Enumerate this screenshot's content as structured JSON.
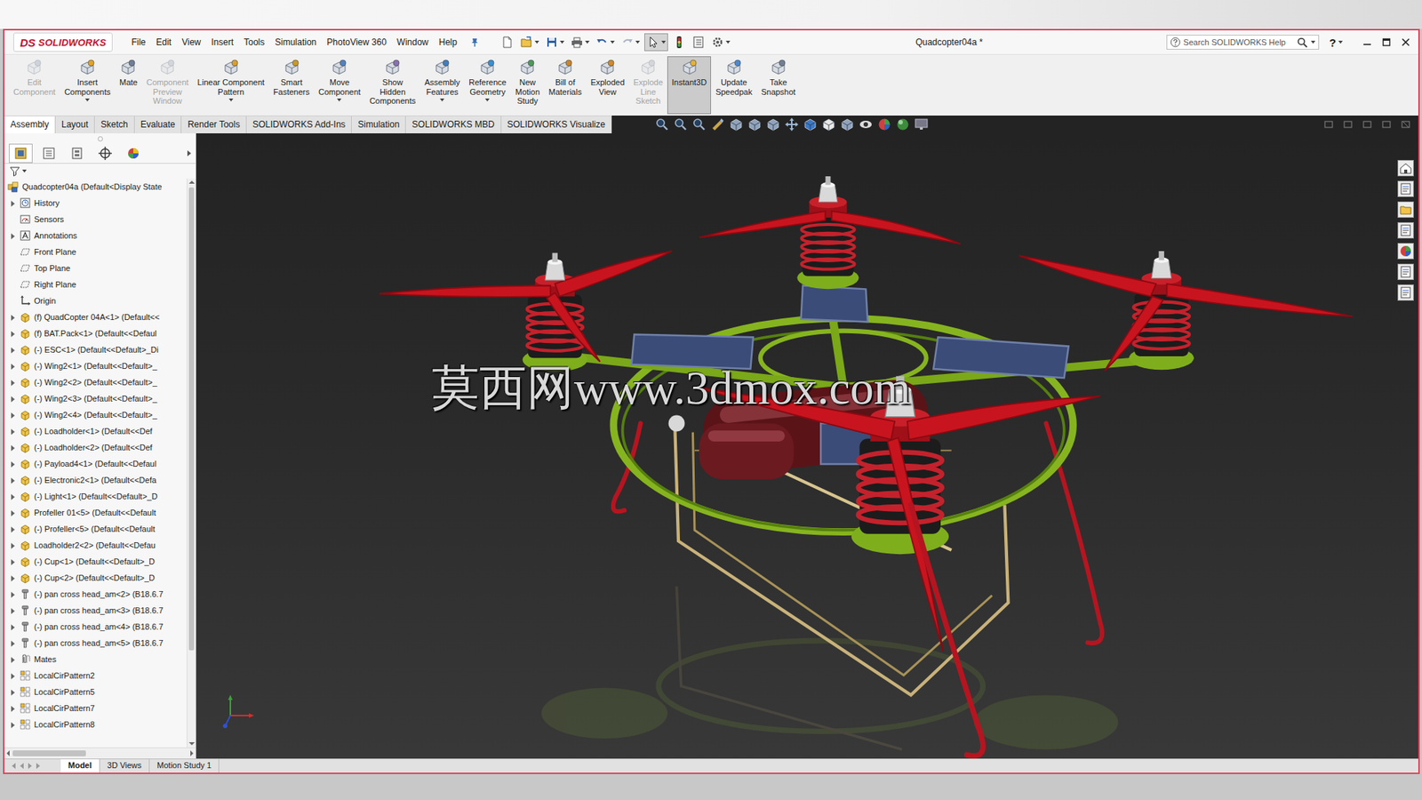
{
  "window": {
    "title": "Quadcopter04a *"
  },
  "logo": {
    "mark": "DS",
    "name": "SOLIDWORKS"
  },
  "menu": [
    "File",
    "Edit",
    "View",
    "Insert",
    "Tools",
    "Simulation",
    "PhotoView 360",
    "Window",
    "Help"
  ],
  "search": {
    "placeholder": "Search SOLIDWORKS Help"
  },
  "help_button": "?",
  "command_buttons": [
    {
      "lines": [
        "Edit",
        "Component"
      ],
      "disabled": true,
      "selected": false,
      "dropdown": false
    },
    {
      "lines": [
        "Insert",
        "Components"
      ],
      "disabled": false,
      "selected": false,
      "dropdown": true
    },
    {
      "lines": [
        "Mate"
      ],
      "disabled": false,
      "selected": false,
      "dropdown": false
    },
    {
      "lines": [
        "Component",
        "Preview",
        "Window"
      ],
      "disabled": true,
      "selected": false,
      "dropdown": false
    },
    {
      "lines": [
        "Linear Component",
        "Pattern"
      ],
      "disabled": false,
      "selected": false,
      "dropdown": true
    },
    {
      "lines": [
        "Smart",
        "Fasteners"
      ],
      "disabled": false,
      "selected": false,
      "dropdown": false
    },
    {
      "lines": [
        "Move",
        "Component"
      ],
      "disabled": false,
      "selected": false,
      "dropdown": true
    },
    {
      "lines": [
        "Show",
        "Hidden",
        "Components"
      ],
      "disabled": false,
      "selected": false,
      "dropdown": false
    },
    {
      "lines": [
        "Assembly",
        "Features"
      ],
      "disabled": false,
      "selected": false,
      "dropdown": true
    },
    {
      "lines": [
        "Reference",
        "Geometry"
      ],
      "disabled": false,
      "selected": false,
      "dropdown": true
    },
    {
      "lines": [
        "New",
        "Motion",
        "Study"
      ],
      "disabled": false,
      "selected": false,
      "dropdown": false
    },
    {
      "lines": [
        "Bill of",
        "Materials"
      ],
      "disabled": false,
      "selected": false,
      "dropdown": false
    },
    {
      "lines": [
        "Exploded",
        "View"
      ],
      "disabled": false,
      "selected": false,
      "dropdown": false
    },
    {
      "lines": [
        "Explode",
        "Line",
        "Sketch"
      ],
      "disabled": true,
      "selected": false,
      "dropdown": false
    },
    {
      "lines": [
        "Instant3D"
      ],
      "disabled": false,
      "selected": true,
      "dropdown": false
    },
    {
      "lines": [
        "Update",
        "Speedpak"
      ],
      "disabled": false,
      "selected": false,
      "dropdown": false
    },
    {
      "lines": [
        "Take",
        "Snapshot"
      ],
      "disabled": false,
      "selected": false,
      "dropdown": false
    }
  ],
  "tabs": [
    {
      "label": "Assembly",
      "selected": true
    },
    {
      "label": "Layout",
      "selected": false
    },
    {
      "label": "Sketch",
      "selected": false
    },
    {
      "label": "Evaluate",
      "selected": false
    },
    {
      "label": "Render Tools",
      "selected": false
    },
    {
      "label": "SOLIDWORKS Add-Ins",
      "selected": false
    },
    {
      "label": "Simulation",
      "selected": false
    },
    {
      "label": "SOLIDWORKS MBD",
      "selected": false
    },
    {
      "label": "SOLIDWORKS Visualize",
      "selected": false
    }
  ],
  "feature_tree": {
    "items": [
      {
        "label": "Quadcopter04a (Default<Display State",
        "kind": "root",
        "expandable": false
      },
      {
        "label": "History",
        "kind": "history",
        "expandable": true
      },
      {
        "label": "Sensors",
        "kind": "sensor",
        "expandable": false
      },
      {
        "label": "Annotations",
        "kind": "annotations",
        "expandable": true
      },
      {
        "label": "Front Plane",
        "kind": "plane",
        "expandable": false
      },
      {
        "label": "Top Plane",
        "kind": "plane",
        "expandable": false
      },
      {
        "label": "Right Plane",
        "kind": "plane",
        "expandable": false
      },
      {
        "label": "Origin",
        "kind": "origin",
        "expandable": false
      },
      {
        "label": "(f) QuadCopter 04A<1> (Default<<",
        "kind": "component",
        "expandable": true
      },
      {
        "label": "(f) BAT.Pack<1> (Default<<Defaul",
        "kind": "component",
        "expandable": true
      },
      {
        "label": "(-) ESC<1> (Default<<Default>_Di",
        "kind": "component",
        "expandable": true
      },
      {
        "label": "(-) Wing2<1> (Default<<Default>_",
        "kind": "component",
        "expandable": true
      },
      {
        "label": "(-) Wing2<2> (Default<<Default>_",
        "kind": "component",
        "expandable": true
      },
      {
        "label": "(-) Wing2<3> (Default<<Default>_",
        "kind": "component",
        "expandable": true
      },
      {
        "label": "(-) Wing2<4> (Default<<Default>_",
        "kind": "component",
        "expandable": true
      },
      {
        "label": "(-) Loadholder<1> (Default<<Def",
        "kind": "component",
        "expandable": true
      },
      {
        "label": "(-) Loadholder<2> (Default<<Def",
        "kind": "component",
        "expandable": true
      },
      {
        "label": "(-) Payload4<1> (Default<<Defaul",
        "kind": "component",
        "expandable": true
      },
      {
        "label": "(-) Electronic2<1> (Default<<Defa",
        "kind": "component",
        "expandable": true
      },
      {
        "label": "(-) Light<1> (Default<<Default>_D",
        "kind": "component",
        "expandable": true
      },
      {
        "label": "Profeller 01<5> (Default<<Default",
        "kind": "component",
        "expandable": true
      },
      {
        "label": "(-) Profeller<5> (Default<<Default",
        "kind": "component",
        "expandable": true
      },
      {
        "label": "Loadholder2<2> (Default<<Defau",
        "kind": "component",
        "expandable": true
      },
      {
        "label": "(-) Cup<1> (Default<<Default>_D",
        "kind": "component",
        "expandable": true
      },
      {
        "label": "(-) Cup<2> (Default<<Default>_D",
        "kind": "component",
        "expandable": true
      },
      {
        "label": "(-) pan cross head_am<2> (B18.6.7",
        "kind": "fastener",
        "expandable": true
      },
      {
        "label": "(-) pan cross head_am<3> (B18.6.7",
        "kind": "fastener",
        "expandable": true
      },
      {
        "label": "(-) pan cross head_am<4> (B18.6.7",
        "kind": "fastener",
        "expandable": true
      },
      {
        "label": "(-) pan cross head_am<5> (B18.6.7",
        "kind": "fastener",
        "expandable": true
      },
      {
        "label": "Mates",
        "kind": "mates",
        "expandable": true
      },
      {
        "label": "LocalCirPattern2",
        "kind": "pattern",
        "expandable": true
      },
      {
        "label": "LocalCirPattern5",
        "kind": "pattern",
        "expandable": true
      },
      {
        "label": "LocalCirPattern7",
        "kind": "pattern",
        "expandable": true
      },
      {
        "label": "LocalCirPattern8",
        "kind": "pattern",
        "expandable": true
      }
    ],
    "vertical_scroll": {
      "level": 0.84
    },
    "horizontal_scroll": {
      "level": 0.42
    }
  },
  "watermark": "莫西网www.3dmox.com",
  "bottom_tabs": [
    {
      "label": "Model",
      "selected": true
    },
    {
      "label": "3D Views",
      "selected": false
    },
    {
      "label": "Motion Study 1",
      "selected": false
    }
  ]
}
